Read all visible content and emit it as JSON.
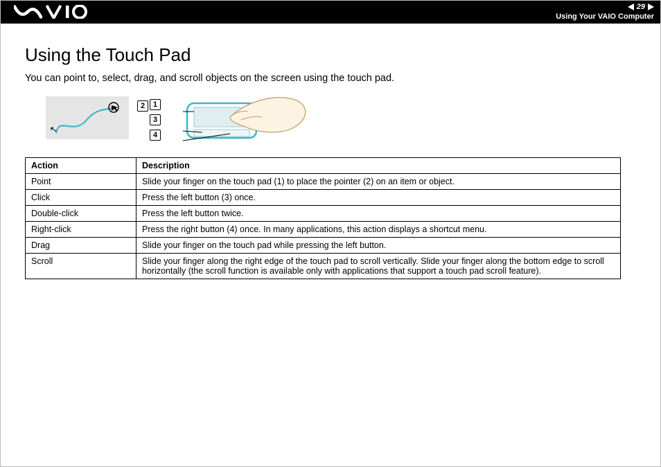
{
  "header": {
    "page_number": "29",
    "section": "Using Your VAIO Computer"
  },
  "title": "Using the Touch Pad",
  "intro": "You can point to, select, drag, and scroll objects on the screen using the touch pad.",
  "callouts": {
    "c1": "1",
    "c2": "2",
    "c3": "3",
    "c4": "4"
  },
  "table": {
    "headers": {
      "action": "Action",
      "description": "Description"
    },
    "rows": [
      {
        "action": "Point",
        "description": "Slide your finger on the touch pad (1) to place the pointer (2) on an item or object."
      },
      {
        "action": "Click",
        "description": "Press the left button (3) once."
      },
      {
        "action": "Double-click",
        "description": "Press the left button twice."
      },
      {
        "action": "Right-click",
        "description": "Press the right button (4) once. In many applications, this action displays a shortcut menu."
      },
      {
        "action": "Drag",
        "description": "Slide your finger on the touch pad while pressing the left button."
      },
      {
        "action": "Scroll",
        "description": "Slide your finger along the right edge of the touch pad to scroll vertically. Slide your finger along the bottom edge to scroll horizontally (the scroll function is available only with applications that support a touch pad scroll feature)."
      }
    ]
  }
}
